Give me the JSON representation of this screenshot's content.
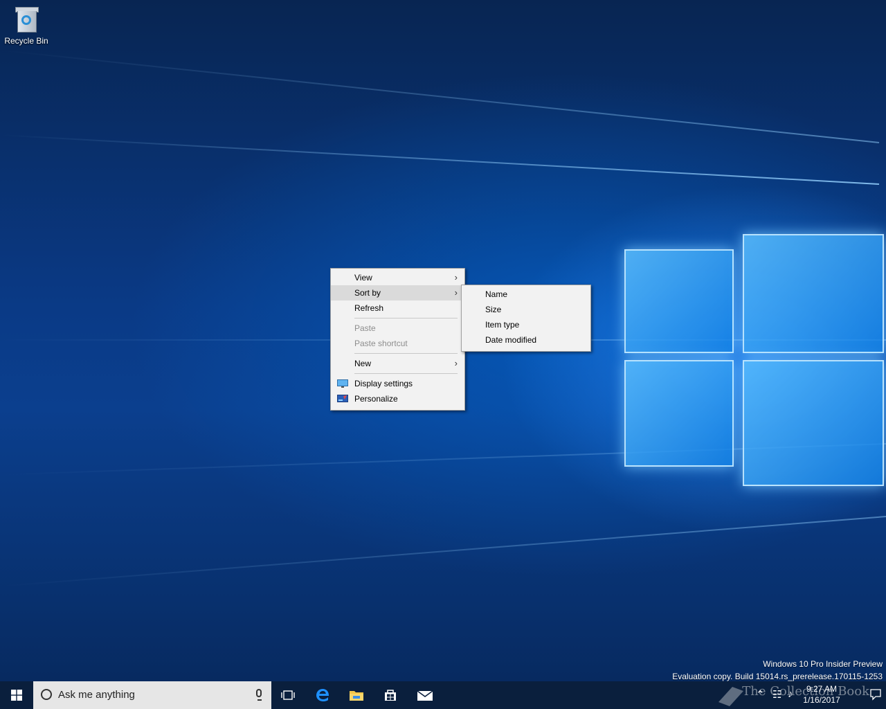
{
  "desktop": {
    "icons": [
      {
        "label": "Recycle Bin",
        "icon": "recycle-bin-icon"
      }
    ],
    "watermark": {
      "line1": "Windows 10 Pro Insider Preview",
      "line2": "Evaluation copy. Build 15014.rs_prerelease.170115-1253"
    }
  },
  "context_menu": {
    "items": {
      "view": "View",
      "sort_by": "Sort by",
      "refresh": "Refresh",
      "paste": "Paste",
      "paste_shortcut": "Paste shortcut",
      "new": "New",
      "display_settings": "Display settings",
      "personalize": "Personalize"
    },
    "highlighted": "Sort by"
  },
  "sort_submenu": {
    "items": [
      "Name",
      "Size",
      "Item type",
      "Date modified"
    ]
  },
  "taskbar": {
    "search_placeholder": "Ask me anything",
    "pinned": [
      "task-view-icon",
      "edge-icon",
      "file-explorer-icon",
      "store-icon",
      "mail-icon"
    ],
    "clock": {
      "time": "9:27 AM",
      "date": "1/16/2017"
    },
    "overlay_text": "The Collection Book"
  },
  "colors": {
    "taskbar": "#0a1f3d",
    "menu_bg": "#f2f2f2",
    "menu_highlight": "#dadada",
    "search_bg": "#e6e6e6"
  }
}
